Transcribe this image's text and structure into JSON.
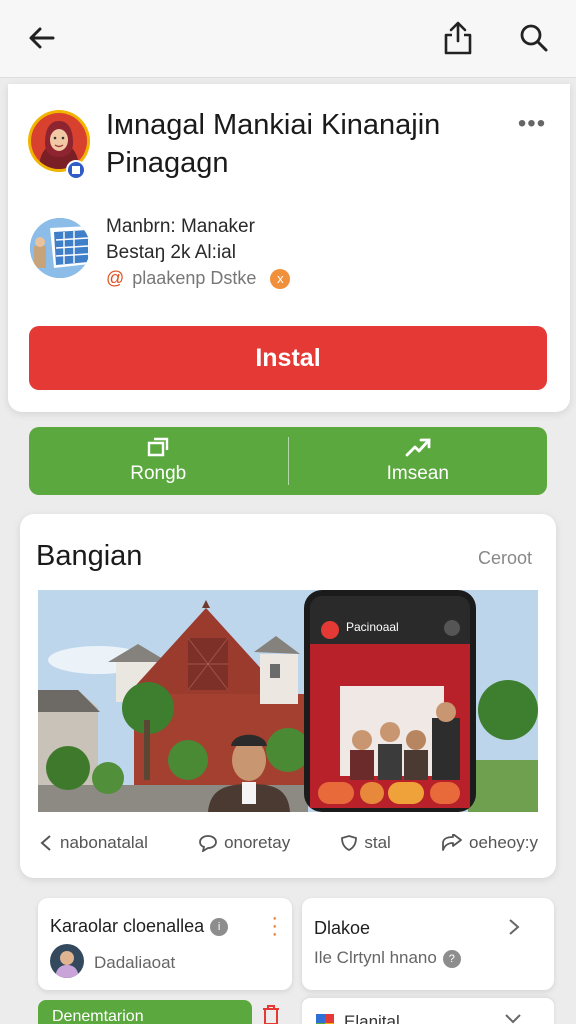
{
  "header": {
    "back_icon": "arrow-left-icon",
    "share_icon": "share-icon",
    "search_icon": "search-icon"
  },
  "app": {
    "title": "Iмnagal Mankiai Kinanajin Pinagagn",
    "developer": {
      "name": "Manbrn: Manaker",
      "stats": "Bestaŋ 2k Al:ial",
      "tag_at": "@",
      "tag_text": "plaakenp Dstke",
      "tag_badge": "x"
    },
    "install_label": "Instal"
  },
  "actions": [
    {
      "label": "Rongb",
      "icon": "window-icon"
    },
    {
      "label": "Imsean",
      "icon": "share-arrow-icon"
    }
  ],
  "gallery_section": {
    "title": "Bangian",
    "link": "Ceroot",
    "phone_header": "Pacinoaal",
    "actions": [
      {
        "label": "nabonatalal",
        "icon": "chevron-left-icon"
      },
      {
        "label": "onoretay",
        "icon": "comment-icon"
      },
      {
        "label": "stal",
        "icon": "shield-icon"
      },
      {
        "label": "oeheoy:y",
        "icon": "reply-icon"
      }
    ]
  },
  "cards": [
    {
      "title": "Karaolar cloenallea",
      "subtitle": "Dadaliaoat"
    },
    {
      "title": "Dlakoe",
      "subtitle": "Ile Clrtynl hnano"
    }
  ],
  "bottom": {
    "left_label": "Denemtarion",
    "right_label": "Elanital"
  },
  "colors": {
    "install": "#e53935",
    "actions": "#5aa83e",
    "brick": "#9a3b2e"
  }
}
